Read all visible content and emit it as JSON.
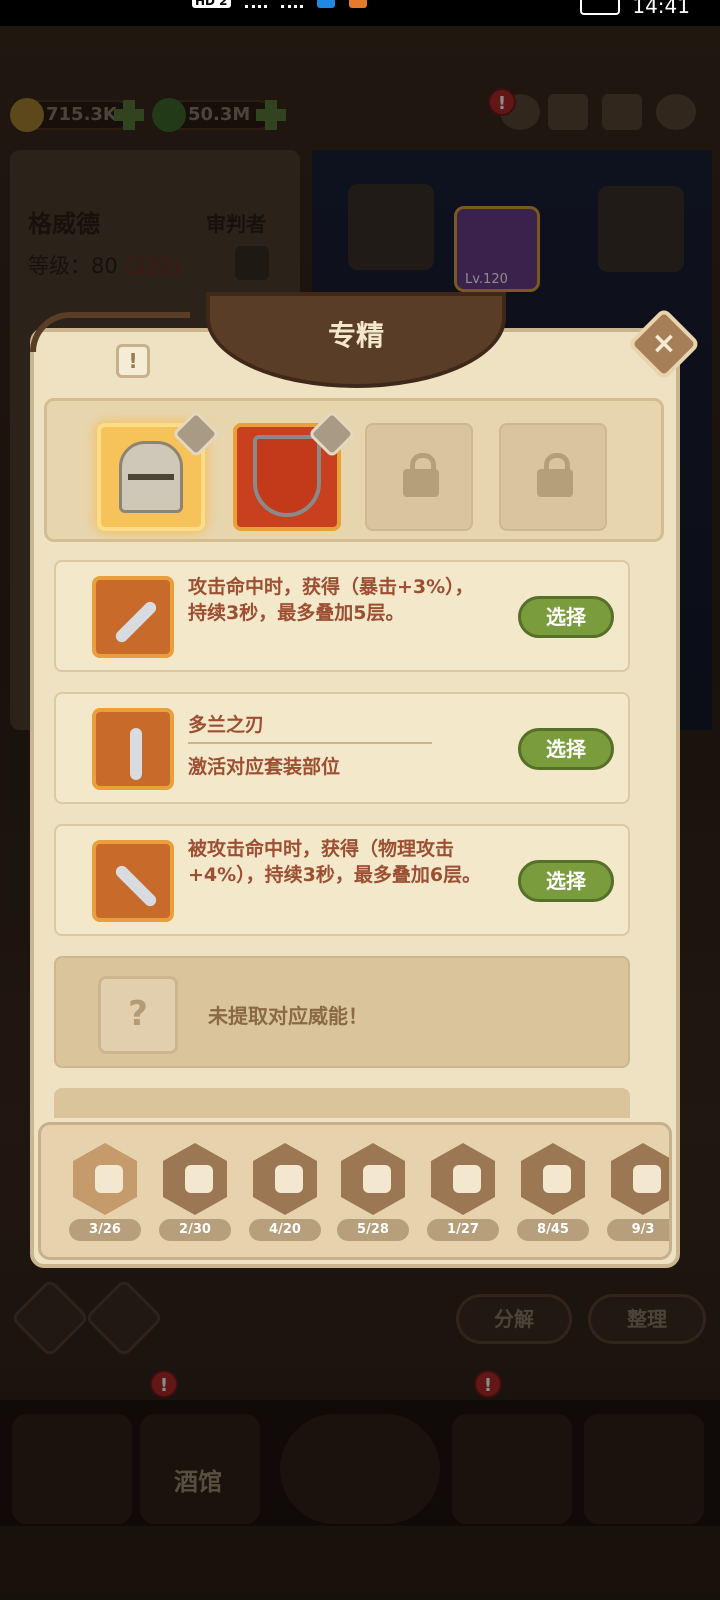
{
  "status_bar": {
    "hd_label": "HD 2",
    "time": "14:41"
  },
  "resources": {
    "gold": "715.3K",
    "leaf": "50.3M"
  },
  "hero": {
    "name": "格威德",
    "role": "审判者",
    "level_label": "等级：",
    "level": "80",
    "level_extra": "(222)"
  },
  "equipment": {
    "item_level": "Lv.120"
  },
  "modal": {
    "title": "专精",
    "close_label": "×",
    "info_label": "!",
    "options": [
      {
        "description": "攻击命中时，获得（暴击+3%），持续3秒，最多叠加5层。",
        "select_label": "选择"
      },
      {
        "title": "多兰之刃",
        "subtitle": "激活对应套装部位",
        "select_label": "选择"
      },
      {
        "description": "被攻击命中时，获得（物理攻击+4%），持续3秒，最多叠加6层。",
        "select_label": "选择"
      }
    ],
    "empty_option": {
      "icon_label": "?",
      "text": "未提取对应威能！"
    },
    "categories": [
      {
        "icon": "boot-icon",
        "count": "3/26"
      },
      {
        "icon": "drumstick-icon",
        "count": "2/30"
      },
      {
        "icon": "sword-icon",
        "count": "4/20"
      },
      {
        "icon": "crossed-shield-icon",
        "count": "5/28"
      },
      {
        "icon": "book-icon",
        "count": "1/27"
      },
      {
        "icon": "helmet-icon",
        "count": "8/45"
      },
      {
        "icon": "magnifier-icon",
        "count": "9/3"
      }
    ]
  },
  "bottom_actions": {
    "decompose": "分解",
    "organize": "整理"
  },
  "nav": {
    "tavern_label": "酒馆"
  },
  "colors": {
    "select_green": "#7b9c3c",
    "text_brown": "#9c4f32",
    "panel_cream": "#efe2c2"
  }
}
